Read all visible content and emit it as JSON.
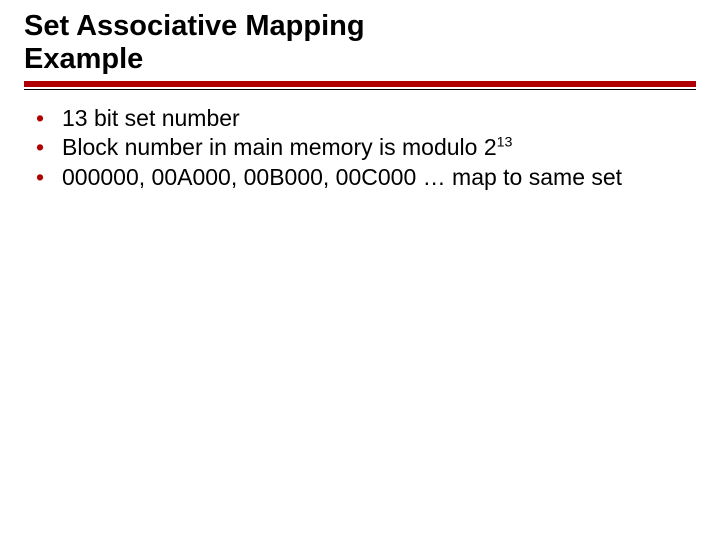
{
  "title_line1": "Set Associative Mapping",
  "title_line2": "Example",
  "bullets": [
    {
      "pre": "13 bit set number",
      "sup": "",
      "post": ""
    },
    {
      "pre": "Block number in main memory is modulo 2",
      "sup": "13",
      "post": ""
    },
    {
      "pre": "000000, 00A000, 00B000, 00C000 … map to same set",
      "sup": "",
      "post": ""
    }
  ],
  "colors": {
    "accent": "#b00000"
  }
}
